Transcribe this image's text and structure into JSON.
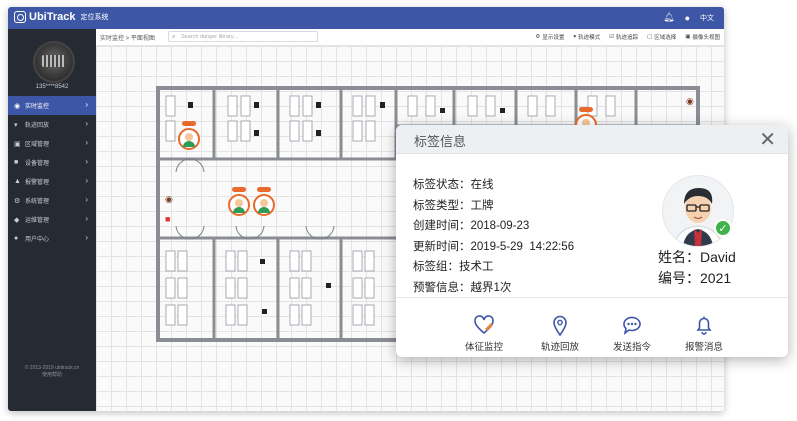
{
  "app": {
    "name": "UbiTrack",
    "subtitle": "定位系统",
    "language": "中文"
  },
  "user": {
    "phone": "135****8542"
  },
  "sidebar": {
    "items": [
      {
        "label": "实时监控",
        "icon": "monitor-icon",
        "active": true
      },
      {
        "label": "轨迹回放",
        "icon": "location-pin-icon",
        "active": false
      },
      {
        "label": "区域管理",
        "icon": "area-icon",
        "active": false
      },
      {
        "label": "设备管理",
        "icon": "device-icon",
        "active": false
      },
      {
        "label": "报警管理",
        "icon": "bell-icon",
        "active": false
      },
      {
        "label": "系统管理",
        "icon": "gear-icon",
        "active": false
      },
      {
        "label": "运维管理",
        "icon": "wrench-icon",
        "active": false
      },
      {
        "label": "用户中心",
        "icon": "user-icon",
        "active": false
      }
    ],
    "copyright_line1": "© 2013-2019 ubitrack.cn",
    "copyright_line2": "使用帮助"
  },
  "toolbar": {
    "breadcrumb": "实时监控 > 平面视图",
    "search_placeholder": "Search danger library...",
    "tools": [
      "显示设置",
      "轨迹模式",
      "轨迹追踪",
      "区域选择",
      "摄像头视图"
    ]
  },
  "popup": {
    "title": "标签信息",
    "fields": [
      {
        "label": "标签状态：",
        "value": "在线"
      },
      {
        "label": "标签类型：",
        "value": "工牌"
      },
      {
        "label": "创建时间：",
        "value": "2018-09-23"
      },
      {
        "label": "更新时间：",
        "value": "2019-5-29  14:22:56"
      },
      {
        "label": "标签组：",
        "value": "技术工"
      },
      {
        "label": "预警信息：",
        "value": "越界1次"
      }
    ],
    "name_label": "姓名：",
    "name": "David",
    "id_label": "编号：",
    "id": "2021",
    "actions": [
      {
        "label": "体征监控",
        "icon": "heart-monitor-icon"
      },
      {
        "label": "轨迹回放",
        "icon": "location-pin-icon"
      },
      {
        "label": "发送指令",
        "icon": "chat-bubble-icon"
      },
      {
        "label": "报警消息",
        "icon": "bell-icon"
      }
    ],
    "accent_color": "#3d56a6",
    "online_color": "#3eb34b"
  },
  "colors": {
    "topbar": "#3d56a6",
    "sidebar": "#252a33",
    "tag_orange": "#ea6a2c"
  }
}
